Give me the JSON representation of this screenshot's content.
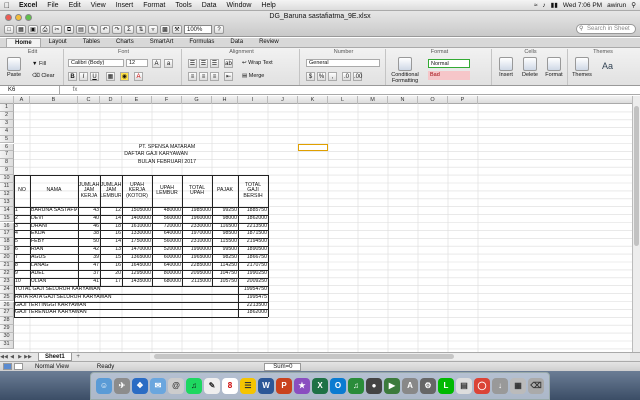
{
  "menubar": {
    "app": "Excel",
    "items": [
      "File",
      "Edit",
      "View",
      "Insert",
      "Format",
      "Tools",
      "Data",
      "Window",
      "Help"
    ],
    "clock": "Wed 7:06 PM",
    "user": "awirun"
  },
  "window": {
    "title": "DG_Baruna sastafiatma_9E.xlsx",
    "zoom": "100%",
    "search_placeholder": "Search in Sheet"
  },
  "ribbon": {
    "tabs": [
      "Home",
      "Layout",
      "Tables",
      "Charts",
      "SmartArt",
      "Formulas",
      "Data",
      "Review"
    ],
    "active_tab": "Home",
    "groups": {
      "edit": "Edit",
      "font": "Font",
      "alignment": "Alignment",
      "number": "Number",
      "format": "Format",
      "cells": "Cells",
      "themes": "Themes"
    },
    "paste": "Paste",
    "fill": "Fill",
    "clear": "Clear",
    "font_name": "Calibri (Body)",
    "font_size": "12",
    "wrap_text": "Wrap Text",
    "merge": "Merge",
    "number_format": "General",
    "conditional_formatting": "Conditional Formatting",
    "style_normal": "Normal",
    "style_bad": "Bad",
    "insert": "Insert",
    "delete": "Delete",
    "format": "Format",
    "themes": "Themes",
    "font_aa": "Aa"
  },
  "formula_bar": {
    "name_box": "K6",
    "fx": "fx"
  },
  "columns": [
    "A",
    "B",
    "C",
    "D",
    "E",
    "F",
    "G",
    "H",
    "I",
    "J",
    "K",
    "L",
    "M",
    "N",
    "O",
    "P"
  ],
  "rows": [
    "1",
    "2",
    "3",
    "4",
    "5",
    "6",
    "7",
    "8",
    "9",
    "10",
    "11",
    "12",
    "13",
    "14",
    "15",
    "16",
    "17",
    "18",
    "19",
    "20",
    "21",
    "22",
    "23",
    "24",
    "25",
    "26",
    "27",
    "28",
    "29",
    "30",
    "31"
  ],
  "sheet": {
    "heading1": "PT. SPENSA MATARAM",
    "heading2": "DAFTAR GAJI KARYAWAN",
    "heading3": "BULAN FEBRUARI 2017",
    "headers": {
      "no": "NO",
      "nama": "NAMA",
      "jam_kerja": "JUMLAH JAM KERJA",
      "jam_lembur": "JUMLAH JAM LEMBUR",
      "upah_kerja": "UPAH KERJA (KOTOR)",
      "upah_lembur": "UPAH LEMBUR",
      "total_upah": "TOTAL UPAH",
      "pajak": "PAJAK",
      "total_gaji": "TOTAL GAJI BERSIH"
    },
    "data": [
      [
        "1",
        "BARUNA SASTAFIATMA",
        "43",
        "12",
        "1505000",
        "480000",
        "1985000",
        "99250",
        "1885750"
      ],
      [
        "2",
        "DEVI",
        "40",
        "14",
        "1400000",
        "560000",
        "1960000",
        "98000",
        "1862000"
      ],
      [
        "3",
        "DHANI",
        "46",
        "18",
        "1610000",
        "720000",
        "2330000",
        "116500",
        "2213500"
      ],
      [
        "4",
        "EKDA",
        "38",
        "16",
        "1330000",
        "640000",
        "1970000",
        "98500",
        "1871500"
      ],
      [
        "5",
        "FEBY",
        "50",
        "14",
        "1750000",
        "560000",
        "2310000",
        "115500",
        "2194500"
      ],
      [
        "6",
        "RIAN",
        "42",
        "13",
        "1470000",
        "520000",
        "1990000",
        "99500",
        "1890500"
      ],
      [
        "7",
        "AGUS",
        "39",
        "15",
        "1365000",
        "600000",
        "1965000",
        "98250",
        "1866750"
      ],
      [
        "8",
        "LANAG",
        "47",
        "16",
        "1645000",
        "640000",
        "2285000",
        "114250",
        "2170750"
      ],
      [
        "9",
        "ADEL",
        "37",
        "20",
        "1295000",
        "800000",
        "2095000",
        "104750",
        "1990250"
      ],
      [
        "10",
        "ULIAN",
        "41",
        "17",
        "1435000",
        "680000",
        "2115000",
        "105750",
        "2009250"
      ]
    ],
    "summary": [
      [
        "TOTAL GAJI SELURUH KARYAWAN",
        "19954750"
      ],
      [
        "RATA RATA GAJI SELURUH KARYAWAN",
        "1995475"
      ],
      [
        "GAJI TERTINGGI KARYAWAN",
        "2213500"
      ],
      [
        "GAJI TERENDAH KARYAWAN",
        "1862000"
      ]
    ]
  },
  "sheet_tabs": [
    "Sheet1"
  ],
  "status": {
    "view": "Normal View",
    "ready": "Ready",
    "sum": "Sum=0"
  }
}
